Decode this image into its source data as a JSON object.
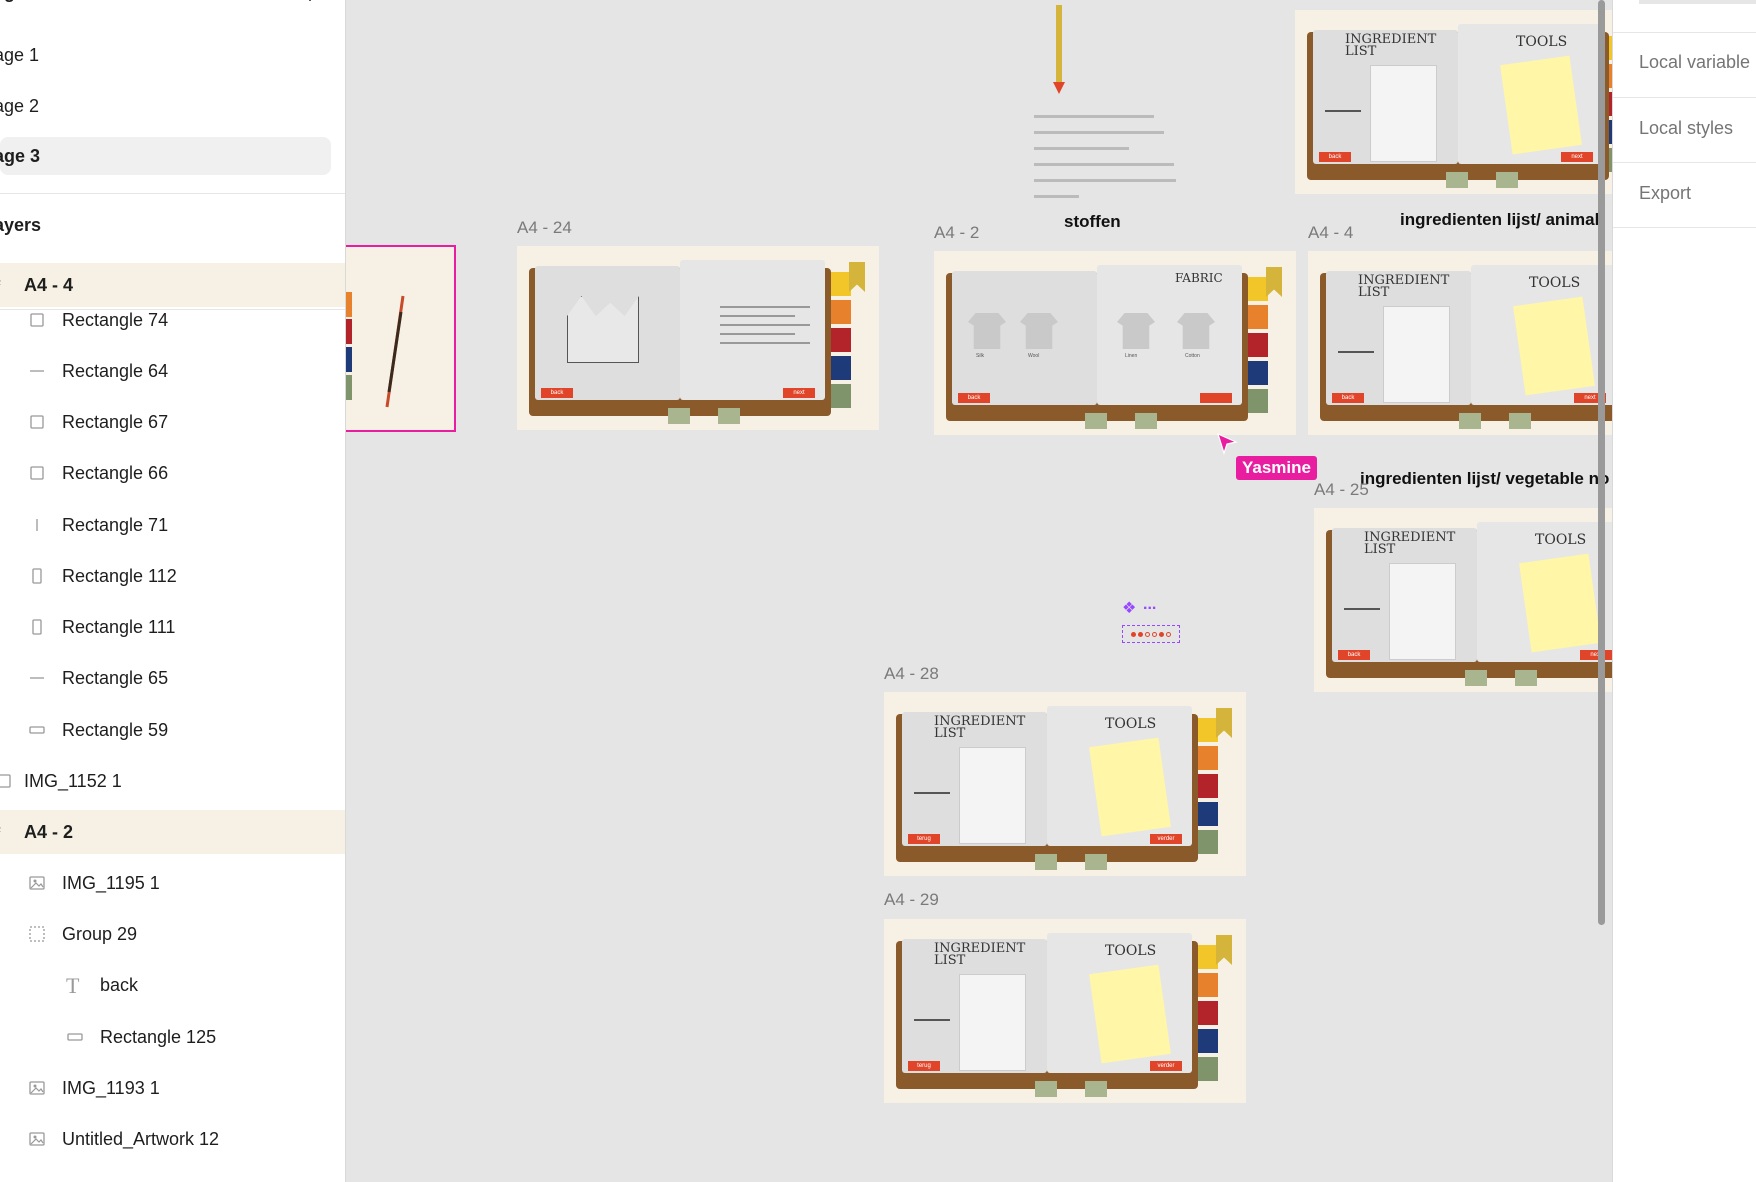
{
  "pages": {
    "header": "ages",
    "items": [
      {
        "label": "age 1"
      },
      {
        "label": "age 2"
      },
      {
        "label": "age 3",
        "active": true
      }
    ]
  },
  "layers": {
    "header": "ayers",
    "items": [
      {
        "label": "A4 - 4",
        "kind": "frame",
        "icon": "hash-icon"
      },
      {
        "label": "Rectangle 74",
        "kind": "rect",
        "icon": "rectangle-icon"
      },
      {
        "label": "Rectangle 64",
        "kind": "line",
        "icon": "line-icon"
      },
      {
        "label": "Rectangle 67",
        "kind": "rect",
        "icon": "rectangle-icon"
      },
      {
        "label": "Rectangle 66",
        "kind": "rect",
        "icon": "rectangle-icon"
      },
      {
        "label": "Rectangle 71",
        "kind": "vline",
        "icon": "vertical-line-icon"
      },
      {
        "label": "Rectangle 112",
        "kind": "tall",
        "icon": "tall-rectangle-icon"
      },
      {
        "label": "Rectangle 111",
        "kind": "tall",
        "icon": "tall-rectangle-icon"
      },
      {
        "label": "Rectangle 65",
        "kind": "line",
        "icon": "line-icon"
      },
      {
        "label": "Rectangle 59",
        "kind": "wide",
        "icon": "wide-rectangle-icon"
      },
      {
        "label": "IMG_1152 1",
        "kind": "image-top",
        "icon": "image-icon"
      },
      {
        "label": "A4 - 2",
        "kind": "frame",
        "icon": "hash-icon"
      },
      {
        "label": "IMG_1195 1",
        "kind": "image",
        "icon": "image-icon"
      },
      {
        "label": "Group 29",
        "kind": "group",
        "icon": "group-icon"
      },
      {
        "label": "back",
        "kind": "text",
        "icon": "text-icon"
      },
      {
        "label": "Rectangle 125",
        "kind": "wide-nested",
        "icon": "wide-rectangle-icon"
      },
      {
        "label": "IMG_1193 1",
        "kind": "image",
        "icon": "image-icon"
      },
      {
        "label": "Untitled_Artwork 12",
        "kind": "image",
        "icon": "image-icon"
      }
    ]
  },
  "canvas": {
    "frames": [
      {
        "id": "a4-24",
        "label": "A4 - 24",
        "variant": "castle",
        "btn_left": "back",
        "btn_right": "next"
      },
      {
        "id": "a4-2",
        "label": "A4 - 2",
        "variant": "fabric",
        "btn_left": "back",
        "btn_right": "",
        "title": "FABRIC"
      },
      {
        "id": "a4-4",
        "label": "A4 - 4",
        "variant": "ingredients",
        "btn_left": "back",
        "btn_right": "next",
        "title_left": "INGREDIENT LIST",
        "title_right": "TOOLS"
      },
      {
        "id": "a4-top",
        "label": "",
        "variant": "ingredients",
        "btn_left": "back",
        "btn_right": "next",
        "title_left": "INGREDIENT LIST",
        "title_right": "TOOLS"
      },
      {
        "id": "a4-25",
        "label": "A4 - 25",
        "variant": "ingredients",
        "btn_left": "back",
        "btn_right": "next",
        "title_left": "INGREDIENT LIST",
        "title_right": "TOOLS"
      },
      {
        "id": "a4-28",
        "label": "A4 - 28",
        "variant": "ingredients",
        "btn_left": "terug",
        "btn_right": "verder",
        "title_left": "INGREDIENT LIST",
        "title_right": "TOOLS"
      },
      {
        "id": "a4-29",
        "label": "A4 - 29",
        "variant": "ingredients",
        "btn_left": "terug",
        "btn_right": "verder",
        "title_left": "INGREDIENT LIST",
        "title_right": "TOOLS"
      }
    ],
    "section_labels": {
      "stoffen": "stoffen",
      "animal": "ingredienten lijst/ animal",
      "vegetable": "ingredienten lijst/ vegetable no"
    },
    "fabric_items": [
      "Silk",
      "Wool",
      "Linen",
      "Cotton"
    ],
    "collaborator": "Yasmine",
    "component_hint": "..."
  },
  "right_panel": {
    "items": [
      {
        "label": "Local variable"
      },
      {
        "label": "Local styles"
      },
      {
        "label": "Export"
      }
    ]
  },
  "colors": {
    "canvas_bg": "#e5e5e5",
    "selection_pink": "#e81da0",
    "frame_bg": "#f6f1e4",
    "book_brown": "#8a5a2b",
    "button_red": "#e0452a",
    "tab_yellow": "#f2c629",
    "tab_orange": "#e8812b",
    "tab_red": "#b3242a",
    "tab_navy": "#1f3a78",
    "tab_green": "#7f946a"
  }
}
